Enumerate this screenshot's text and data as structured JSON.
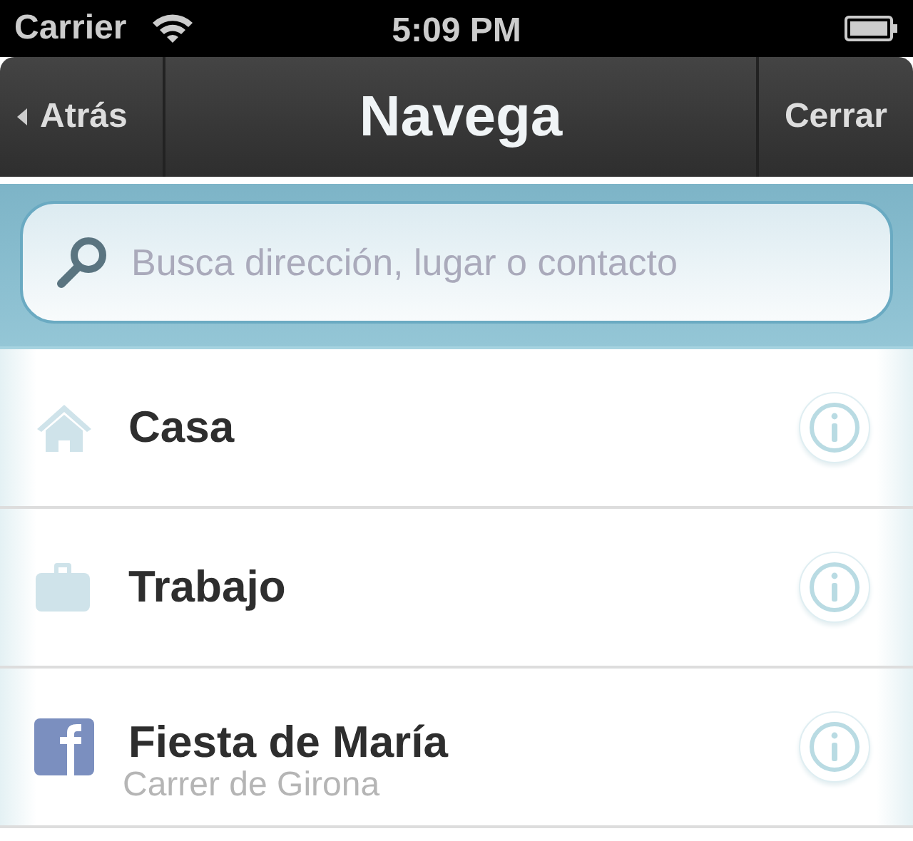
{
  "status_bar": {
    "carrier": "Carrier",
    "time": "5:09 PM"
  },
  "nav_bar": {
    "back": "Atrás",
    "title": "Navega",
    "close": "Cerrar"
  },
  "search": {
    "placeholder": "Busca dirección, lugar o contacto"
  },
  "places": [
    {
      "kind": "home",
      "title": "Casa"
    },
    {
      "kind": "work",
      "title": "Trabajo"
    },
    {
      "kind": "social",
      "title": "Fiesta de María",
      "subtitle": "Carrer de Girona"
    }
  ]
}
